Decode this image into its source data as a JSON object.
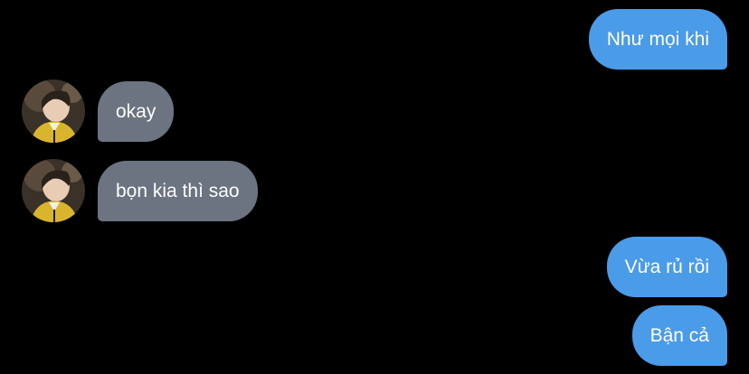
{
  "conversation": {
    "messages": [
      {
        "direction": "outgoing",
        "text": "Như mọi khi"
      },
      {
        "direction": "incoming",
        "text": "okay",
        "avatar": "user-avatar-photo"
      },
      {
        "direction": "incoming",
        "text": "bọn kia thì sao",
        "avatar": "user-avatar-photo"
      },
      {
        "direction": "outgoing",
        "text": "Vừa rủ rồi"
      },
      {
        "direction": "outgoing",
        "text": "Bận cả"
      }
    ]
  },
  "colors": {
    "background": "#000000",
    "outgoing_bubble": "#4a9be8",
    "incoming_bubble": "#6b7480",
    "bubble_text": "#ffffff"
  }
}
